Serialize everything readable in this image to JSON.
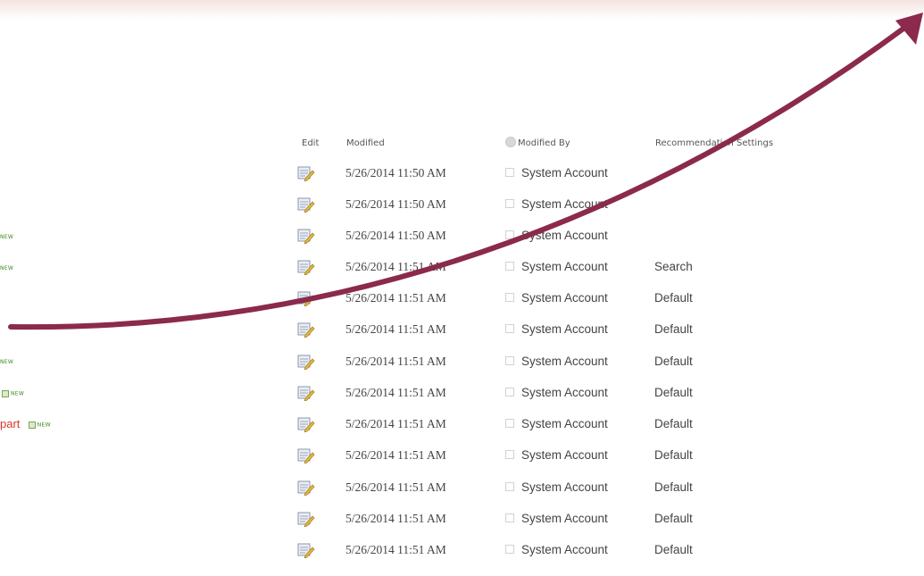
{
  "columns": {
    "edit": "Edit",
    "modified": "Modified",
    "modified_by": "Modified By",
    "recommendation_settings": "Recommendation Settings"
  },
  "rows": [
    {
      "modified": "5/26/2014 11:50 AM",
      "modified_by": "System Account",
      "recommendation": ""
    },
    {
      "modified": "5/26/2014 11:50 AM",
      "modified_by": "System Account",
      "recommendation": ""
    },
    {
      "modified": "5/26/2014 11:50 AM",
      "modified_by": "System Account",
      "recommendation": ""
    },
    {
      "modified": "5/26/2014 11:51 AM",
      "modified_by": "System Account",
      "recommendation": "Search"
    },
    {
      "modified": "5/26/2014 11:51 AM",
      "modified_by": "System Account",
      "recommendation": "Default"
    },
    {
      "modified": "5/26/2014 11:51 AM",
      "modified_by": "System Account",
      "recommendation": "Default"
    },
    {
      "modified": "5/26/2014 11:51 AM",
      "modified_by": "System Account",
      "recommendation": "Default"
    },
    {
      "modified": "5/26/2014 11:51 AM",
      "modified_by": "System Account",
      "recommendation": "Default"
    },
    {
      "modified": "5/26/2014 11:51 AM",
      "modified_by": "System Account",
      "recommendation": "Default"
    },
    {
      "modified": "5/26/2014 11:51 AM",
      "modified_by": "System Account",
      "recommendation": "Default"
    },
    {
      "modified": "5/26/2014 11:51 AM",
      "modified_by": "System Account",
      "recommendation": "Default"
    },
    {
      "modified": "5/26/2014 11:51 AM",
      "modified_by": "System Account",
      "recommendation": "Default"
    },
    {
      "modified": "5/26/2014 11:51 AM",
      "modified_by": "System Account",
      "recommendation": "Default"
    }
  ],
  "left_fragments": {
    "badge_text": "NEW",
    "red_link": "part"
  },
  "colors": {
    "arrow": "#8b2a4c",
    "new_badge": "#3d8a1e",
    "link_red": "#d8362b"
  },
  "icons": {
    "edit": "edit-document-icon",
    "select_all": "select-all-circle-icon",
    "arrow": "arrow-annotation-icon"
  }
}
